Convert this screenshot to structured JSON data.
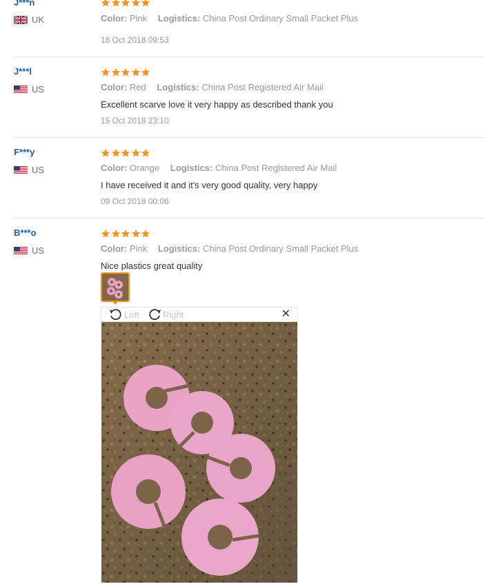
{
  "reviews": [
    {
      "user": "J***n",
      "country": "UK",
      "flag": "uk",
      "rating": 5,
      "color_label": "Color:",
      "color_value": "Pink",
      "logistics_label": "Logistics:",
      "logistics_value": "China Post Ordinary Small Packet Plus",
      "text": "",
      "date": "18 Oct 2018 09:53"
    },
    {
      "user": "J***l",
      "country": "US",
      "flag": "us",
      "rating": 5,
      "color_label": "Color:",
      "color_value": "Red",
      "logistics_label": "Logistics:",
      "logistics_value": "China Post Registered Air Mail",
      "text": "Excellent scarve love it very happy as described thank you",
      "date": "15 Oct 2018 23:10"
    },
    {
      "user": "F***y",
      "country": "US",
      "flag": "us",
      "rating": 5,
      "color_label": "Color:",
      "color_value": "Orange",
      "logistics_label": "Logistics:",
      "logistics_value": "China Post Registered Air Mail",
      "text": "I have received it and it's very good quality, very happy",
      "date": "09 Oct 2018 00:06"
    },
    {
      "user": "B***o",
      "country": "US",
      "flag": "us",
      "rating": 5,
      "color_label": "Color:",
      "color_value": "Pink",
      "logistics_label": "Logistics:",
      "logistics_value": "China Post Ordinary Small Packet Plus",
      "text": "Nice plastics great quality",
      "date": ""
    }
  ],
  "viewer": {
    "rotate_left_label": "Left",
    "rotate_right_label": "Right",
    "close_icon": "close-icon"
  },
  "colors": {
    "star": "#f7941d",
    "username": "#1e5ea8",
    "muted": "#999999",
    "thumb_border": "#f7941d"
  }
}
